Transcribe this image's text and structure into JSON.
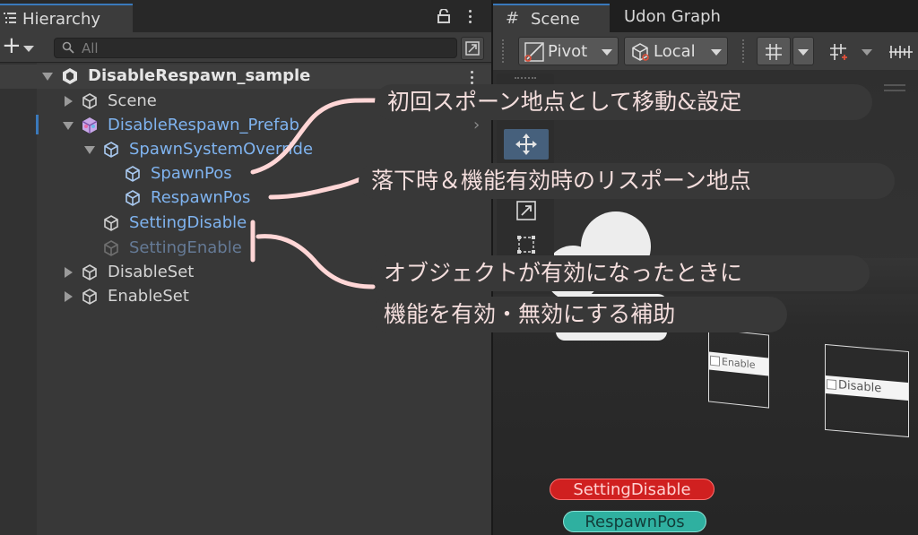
{
  "hierarchy": {
    "tab_label": "Hierarchy",
    "search_placeholder": "All",
    "root": "DisableRespawn_sample",
    "rows": [
      {
        "label": "Scene"
      },
      {
        "label": "DisableRespawn_Prefab"
      },
      {
        "label": "SpawnSystemOverride"
      },
      {
        "label": "SpawnPos"
      },
      {
        "label": "RespawnPos"
      },
      {
        "label": "SettingDisable"
      },
      {
        "label": "SettingEnable"
      },
      {
        "label": "DisableSet"
      },
      {
        "label": "EnableSet"
      }
    ]
  },
  "scene": {
    "tabs": [
      "Scene",
      "Udon Graph"
    ],
    "toolbar": {
      "pivot_label": "Pivot",
      "local_label": "Local"
    },
    "panels": [
      {
        "label": "Enable"
      },
      {
        "label": "Disable"
      }
    ],
    "pills": {
      "disable": "SettingDisable",
      "respawn": "RespawnPos"
    }
  },
  "annotations": [
    "初回スポーン地点として移動&設定",
    "落下時＆機能有効時のリスポーン地点",
    "オブジェクトが有効になったときに",
    "機能を有効・無効にする補助"
  ],
  "colors": {
    "accent_blue": "#3a79bb",
    "prefab_text": "#7fb3ef",
    "disabled_text": "#657a96",
    "annotation_text": "#f4dedd",
    "annotation_line": "#ffd6d6",
    "pill_red": "#d02020",
    "pill_teal": "#2fb0a0"
  }
}
